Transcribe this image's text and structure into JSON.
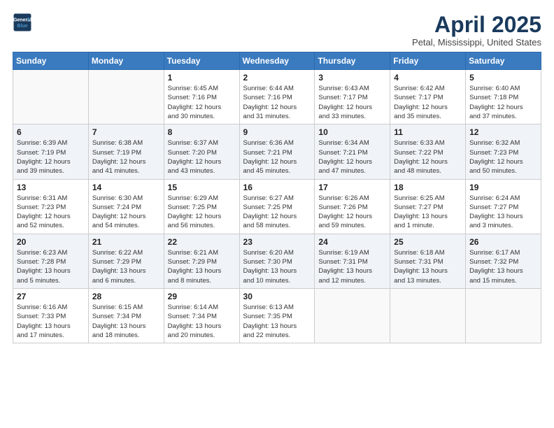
{
  "logo": {
    "line1": "General",
    "line2": "Blue"
  },
  "title": "April 2025",
  "subtitle": "Petal, Mississippi, United States",
  "weekdays": [
    "Sunday",
    "Monday",
    "Tuesday",
    "Wednesday",
    "Thursday",
    "Friday",
    "Saturday"
  ],
  "weeks": [
    [
      {
        "day": "",
        "info": ""
      },
      {
        "day": "",
        "info": ""
      },
      {
        "day": "1",
        "info": "Sunrise: 6:45 AM\nSunset: 7:16 PM\nDaylight: 12 hours\nand 30 minutes."
      },
      {
        "day": "2",
        "info": "Sunrise: 6:44 AM\nSunset: 7:16 PM\nDaylight: 12 hours\nand 31 minutes."
      },
      {
        "day": "3",
        "info": "Sunrise: 6:43 AM\nSunset: 7:17 PM\nDaylight: 12 hours\nand 33 minutes."
      },
      {
        "day": "4",
        "info": "Sunrise: 6:42 AM\nSunset: 7:17 PM\nDaylight: 12 hours\nand 35 minutes."
      },
      {
        "day": "5",
        "info": "Sunrise: 6:40 AM\nSunset: 7:18 PM\nDaylight: 12 hours\nand 37 minutes."
      }
    ],
    [
      {
        "day": "6",
        "info": "Sunrise: 6:39 AM\nSunset: 7:19 PM\nDaylight: 12 hours\nand 39 minutes."
      },
      {
        "day": "7",
        "info": "Sunrise: 6:38 AM\nSunset: 7:19 PM\nDaylight: 12 hours\nand 41 minutes."
      },
      {
        "day": "8",
        "info": "Sunrise: 6:37 AM\nSunset: 7:20 PM\nDaylight: 12 hours\nand 43 minutes."
      },
      {
        "day": "9",
        "info": "Sunrise: 6:36 AM\nSunset: 7:21 PM\nDaylight: 12 hours\nand 45 minutes."
      },
      {
        "day": "10",
        "info": "Sunrise: 6:34 AM\nSunset: 7:21 PM\nDaylight: 12 hours\nand 47 minutes."
      },
      {
        "day": "11",
        "info": "Sunrise: 6:33 AM\nSunset: 7:22 PM\nDaylight: 12 hours\nand 48 minutes."
      },
      {
        "day": "12",
        "info": "Sunrise: 6:32 AM\nSunset: 7:23 PM\nDaylight: 12 hours\nand 50 minutes."
      }
    ],
    [
      {
        "day": "13",
        "info": "Sunrise: 6:31 AM\nSunset: 7:23 PM\nDaylight: 12 hours\nand 52 minutes."
      },
      {
        "day": "14",
        "info": "Sunrise: 6:30 AM\nSunset: 7:24 PM\nDaylight: 12 hours\nand 54 minutes."
      },
      {
        "day": "15",
        "info": "Sunrise: 6:29 AM\nSunset: 7:25 PM\nDaylight: 12 hours\nand 56 minutes."
      },
      {
        "day": "16",
        "info": "Sunrise: 6:27 AM\nSunset: 7:25 PM\nDaylight: 12 hours\nand 58 minutes."
      },
      {
        "day": "17",
        "info": "Sunrise: 6:26 AM\nSunset: 7:26 PM\nDaylight: 12 hours\nand 59 minutes."
      },
      {
        "day": "18",
        "info": "Sunrise: 6:25 AM\nSunset: 7:27 PM\nDaylight: 13 hours\nand 1 minute."
      },
      {
        "day": "19",
        "info": "Sunrise: 6:24 AM\nSunset: 7:27 PM\nDaylight: 13 hours\nand 3 minutes."
      }
    ],
    [
      {
        "day": "20",
        "info": "Sunrise: 6:23 AM\nSunset: 7:28 PM\nDaylight: 13 hours\nand 5 minutes."
      },
      {
        "day": "21",
        "info": "Sunrise: 6:22 AM\nSunset: 7:29 PM\nDaylight: 13 hours\nand 6 minutes."
      },
      {
        "day": "22",
        "info": "Sunrise: 6:21 AM\nSunset: 7:29 PM\nDaylight: 13 hours\nand 8 minutes."
      },
      {
        "day": "23",
        "info": "Sunrise: 6:20 AM\nSunset: 7:30 PM\nDaylight: 13 hours\nand 10 minutes."
      },
      {
        "day": "24",
        "info": "Sunrise: 6:19 AM\nSunset: 7:31 PM\nDaylight: 13 hours\nand 12 minutes."
      },
      {
        "day": "25",
        "info": "Sunrise: 6:18 AM\nSunset: 7:31 PM\nDaylight: 13 hours\nand 13 minutes."
      },
      {
        "day": "26",
        "info": "Sunrise: 6:17 AM\nSunset: 7:32 PM\nDaylight: 13 hours\nand 15 minutes."
      }
    ],
    [
      {
        "day": "27",
        "info": "Sunrise: 6:16 AM\nSunset: 7:33 PM\nDaylight: 13 hours\nand 17 minutes."
      },
      {
        "day": "28",
        "info": "Sunrise: 6:15 AM\nSunset: 7:34 PM\nDaylight: 13 hours\nand 18 minutes."
      },
      {
        "day": "29",
        "info": "Sunrise: 6:14 AM\nSunset: 7:34 PM\nDaylight: 13 hours\nand 20 minutes."
      },
      {
        "day": "30",
        "info": "Sunrise: 6:13 AM\nSunset: 7:35 PM\nDaylight: 13 hours\nand 22 minutes."
      },
      {
        "day": "",
        "info": ""
      },
      {
        "day": "",
        "info": ""
      },
      {
        "day": "",
        "info": ""
      }
    ]
  ]
}
